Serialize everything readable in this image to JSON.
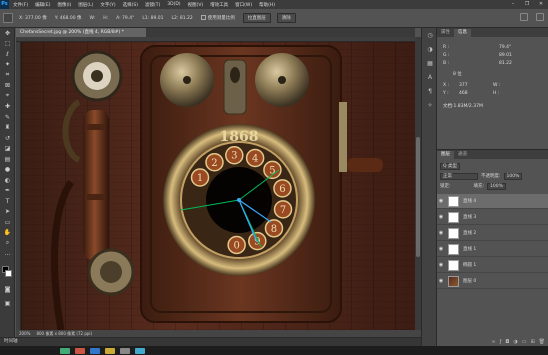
{
  "app": {
    "logo": "Ps"
  },
  "menu": [
    "文件(F)",
    "编辑(E)",
    "图像(I)",
    "图层(L)",
    "文字(Y)",
    "选择(S)",
    "滤镜(T)",
    "3D(D)",
    "视图(V)",
    "增效工具",
    "窗口(W)",
    "帮助(H)"
  ],
  "window_controls": [
    "–",
    "❐",
    "✕"
  ],
  "options_bar": {
    "x": "X: 377.00 像",
    "y": "Y: 468.00 像",
    "angle": "A: 79.4°",
    "length": "L1: 89.01",
    "l2": "L2: 81.22",
    "use_scale": "使用测量比例",
    "straighten": "拉直图层",
    "clear": "清除"
  },
  "document": {
    "tab": "ChefansSecret.jpg @ 200% (直线 4, RGB/8#) *",
    "zoom": "200%",
    "size": "800 像素 x 800 像素 (72 ppi)"
  },
  "timeline": {
    "label": "时间轴"
  },
  "colors": {
    "accent": "#31a8ff",
    "panel": "#535353",
    "dark": "#3c3c3c"
  },
  "tools": [
    "move-icon",
    "marquee-icon",
    "lasso-icon",
    "wand-icon",
    "crop-icon",
    "frame-icon",
    "eyedropper-icon",
    "heal-icon",
    "brush-icon",
    "stamp-icon",
    "history-brush-icon",
    "eraser-icon",
    "gradient-icon",
    "blur-icon",
    "dodge-icon",
    "pen-icon",
    "type-icon",
    "path-select-icon",
    "shape-icon",
    "hand-icon",
    "zoom-icon",
    "more-icon"
  ],
  "info_panel": {
    "tabs": [
      "属性",
      "信息"
    ],
    "active_tab": "信息",
    "r": "R :",
    "g": "G :",
    "b": "B :",
    "deg": "79.4°",
    "d1": "89.01",
    "d2": "81.22",
    "bit": "8 位",
    "x_label": "X :",
    "y_label": "Y :",
    "x_val": "377",
    "y_val": "468",
    "w_label": "W :",
    "h_label": "H :",
    "doc": "文档:1.83M/2.37M"
  },
  "layers_panel": {
    "tabs": [
      "图层",
      "通道"
    ],
    "active_tab": "图层",
    "kind": "Q 类型",
    "blend": "正常",
    "opacity_label": "不透明度:",
    "opacity": "100%",
    "lock_label": "锁定:",
    "fill_label": "填充:",
    "fill": "100%",
    "layers": [
      {
        "name": "直线 4",
        "selected": true,
        "image": false
      },
      {
        "name": "直线 3",
        "selected": false,
        "image": false
      },
      {
        "name": "直线 2",
        "selected": false,
        "image": false
      },
      {
        "name": "直线 1",
        "selected": false,
        "image": false
      },
      {
        "name": "椭圆 1",
        "selected": false,
        "image": false
      },
      {
        "name": "图层 0",
        "selected": false,
        "image": true
      }
    ],
    "footer_icons": [
      "link-icon",
      "fx-icon",
      "mask-icon",
      "adjust-icon",
      "folder-icon",
      "new-layer-icon",
      "trash-icon"
    ]
  },
  "phone": {
    "year": "1868",
    "dial_numbers": [
      "1",
      "2",
      "3",
      "4",
      "5",
      "6",
      "7",
      "8",
      "9",
      "0"
    ]
  }
}
